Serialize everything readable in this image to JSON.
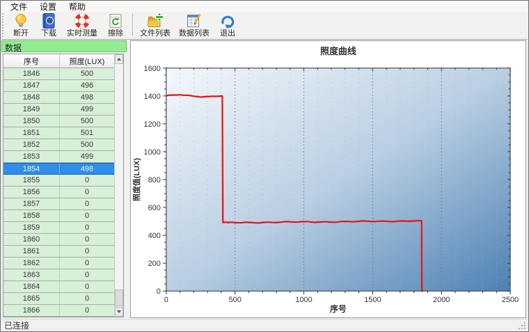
{
  "menu_bar": {
    "items": [
      {
        "label": "文件"
      },
      {
        "label": "设置"
      },
      {
        "label": "帮助"
      }
    ]
  },
  "toolbar": {
    "buttons": [
      {
        "label": "断开",
        "icon": "bulb-icon"
      },
      {
        "label": "下载",
        "icon": "address-book-icon"
      },
      {
        "label": "实时测量",
        "icon": "lifebuoy-icon"
      },
      {
        "label": "擦除",
        "icon": "erase-recycle-icon"
      },
      {
        "label": "文件列表",
        "icon": "folder-plus-icon"
      },
      {
        "label": "数据列表",
        "icon": "data-table-pencil-icon"
      },
      {
        "label": "退出",
        "icon": "exit-arrow-icon"
      }
    ]
  },
  "left_panel": {
    "title": "数据",
    "table": {
      "columns": [
        "序号",
        "照度(LUX)"
      ],
      "rows": [
        [
          1846,
          500
        ],
        [
          1847,
          496
        ],
        [
          1848,
          498
        ],
        [
          1849,
          499
        ],
        [
          1850,
          500
        ],
        [
          1851,
          501
        ],
        [
          1852,
          500
        ],
        [
          1853,
          499
        ],
        [
          1854,
          498
        ],
        [
          1855,
          0
        ],
        [
          1856,
          0
        ],
        [
          1857,
          0
        ],
        [
          1858,
          0
        ],
        [
          1859,
          0
        ],
        [
          1860,
          0
        ],
        [
          1861,
          0
        ],
        [
          1862,
          0
        ],
        [
          1863,
          0
        ],
        [
          1864,
          0
        ],
        [
          1865,
          0
        ],
        [
          1866,
          0
        ]
      ],
      "selected_row_index": 8
    }
  },
  "status_bar": {
    "text": "已连接"
  },
  "colors": {
    "panel_green": "#90ee90",
    "row_green": "#d8efd8",
    "selected_blue": "#2e8ee9",
    "curve_red": "#ec1011",
    "plot_gradient": [
      "#f4f8fb",
      "#bacfe3",
      "#4c81b4"
    ],
    "grid_minor": "#a8b2ba",
    "grid_major": "#6d7780",
    "frame": "#4d4d4d"
  },
  "chart_data": {
    "type": "line",
    "title": "照度曲线",
    "xlabel": "序号",
    "ylabel": "照度值(LUX)",
    "xlim": [
      0,
      2500
    ],
    "ylim": [
      0,
      1600
    ],
    "x_major_step": 500,
    "x_minor_step": 100,
    "y_major_step": 200,
    "y_minor_step": 50,
    "grid": "vertical-dotted",
    "legend_position": "none",
    "series": [
      {
        "name": "照度",
        "color": "#ec1011",
        "points": [
          [
            0,
            1401
          ],
          [
            40,
            1404
          ],
          [
            80,
            1407
          ],
          [
            110,
            1408
          ],
          [
            150,
            1405
          ],
          [
            190,
            1400
          ],
          [
            230,
            1397
          ],
          [
            270,
            1395
          ],
          [
            310,
            1395
          ],
          [
            350,
            1397
          ],
          [
            390,
            1399
          ],
          [
            408,
            1400
          ],
          [
            412,
            492
          ],
          [
            450,
            490
          ],
          [
            520,
            491
          ],
          [
            600,
            492
          ],
          [
            700,
            493
          ],
          [
            800,
            494
          ],
          [
            900,
            495
          ],
          [
            1000,
            496
          ],
          [
            1100,
            496
          ],
          [
            1200,
            497
          ],
          [
            1300,
            498
          ],
          [
            1400,
            499
          ],
          [
            1500,
            500
          ],
          [
            1600,
            501
          ],
          [
            1700,
            502
          ],
          [
            1780,
            503
          ],
          [
            1840,
            504
          ],
          [
            1853,
            505
          ],
          [
            1856,
            505
          ],
          [
            1858,
            0
          ],
          [
            1866,
            0
          ]
        ]
      }
    ]
  }
}
